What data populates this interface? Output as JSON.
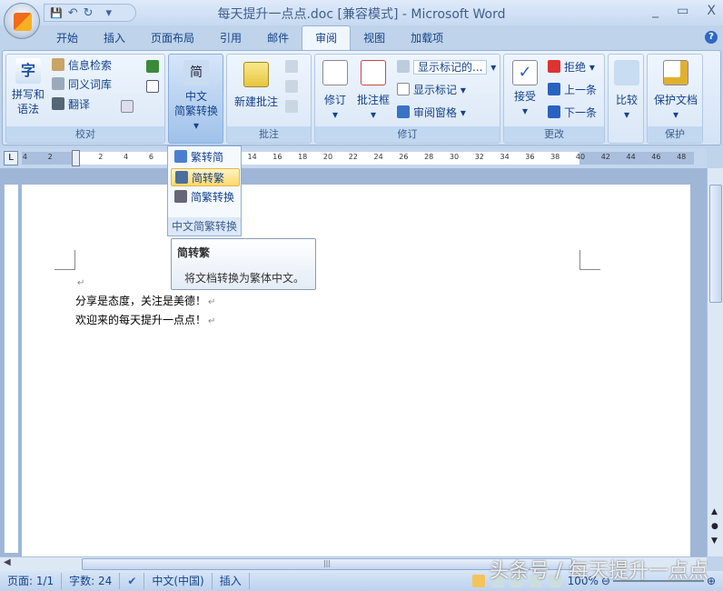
{
  "window": {
    "title": "每天提升一点点.doc [兼容模式] - Microsoft Word",
    "minimize": "_",
    "maximize": "▭",
    "close": "X",
    "help": "?"
  },
  "qat": {
    "save": "💾",
    "undo": "↶",
    "redo": "↻",
    "more": "▾"
  },
  "tabs": [
    "开始",
    "插入",
    "页面布局",
    "引用",
    "邮件",
    "审阅",
    "视图",
    "加载项"
  ],
  "active_tab": "审阅",
  "ribbon": {
    "proofing": {
      "label": "校对",
      "spell": "拼写和\n语法",
      "research": "信息检索",
      "thesaurus": "同义词库",
      "translate": "翻译"
    },
    "chinese": {
      "label_line1": "中文",
      "label_line2": "简繁转换 ▾"
    },
    "comments": {
      "label": "批注",
      "new_comment": "新建批注"
    },
    "tracking": {
      "label": "修订",
      "track": "修订",
      "balloons": "批注框",
      "display_dropdown": "显示标记的...",
      "show_markup": "显示标记 ▾",
      "reviewing_pane": "审阅窗格 ▾"
    },
    "changes": {
      "label": "更改",
      "accept": "接受",
      "reject": "拒绝 ▾",
      "previous": "上一条",
      "next": "下一条"
    },
    "compare": {
      "label": "比较"
    },
    "protect": {
      "label": "保护",
      "protect_doc": "保护文档"
    }
  },
  "dropdown_menu": {
    "items": [
      "繁转简",
      "简转繁",
      "简繁转换"
    ],
    "highlighted": "简转繁",
    "footer": "中文简繁转换"
  },
  "tooltip": {
    "title": "简转繁",
    "description": "将文档转换为繁体中文。"
  },
  "ruler": {
    "ticks": [
      "4",
      "2",
      "2",
      "4",
      "6",
      "14",
      "16",
      "18",
      "20",
      "22",
      "24",
      "26",
      "28",
      "30",
      "32",
      "34",
      "36",
      "38",
      "40",
      "42",
      "44",
      "46",
      "48"
    ]
  },
  "document": {
    "lines": [
      "分享是态度，关注是美德！",
      "欢迎来的每天提升一点点！"
    ],
    "paragraph_mark": "↵"
  },
  "status": {
    "page": "页面: 1/1",
    "words": "字数: 24",
    "language": "中文(中国)",
    "mode": "插入",
    "zoom": "100%"
  },
  "watermark": "头条号 / 每天提升一点点"
}
